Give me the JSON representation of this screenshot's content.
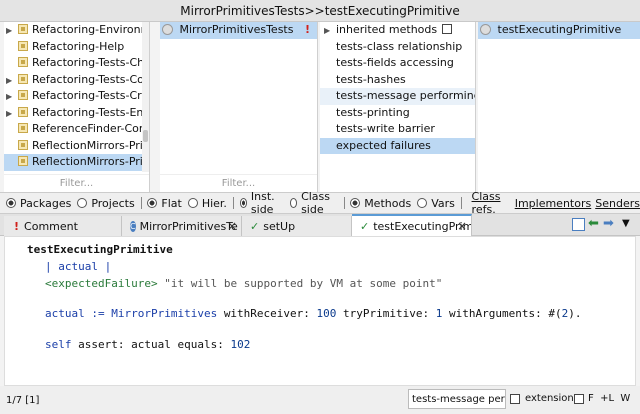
{
  "window": {
    "title": "MirrorPrimitivesTests>>testExecutingPrimitive"
  },
  "packages": {
    "items": [
      {
        "label": "Refactoring-Environment",
        "arrow": "▶",
        "selected": false
      },
      {
        "label": "Refactoring-Help",
        "arrow": "",
        "selected": false
      },
      {
        "label": "Refactoring-Tests-Changes",
        "arrow": "",
        "selected": false
      },
      {
        "label": "Refactoring-Tests-Core",
        "arrow": "▶",
        "selected": false
      },
      {
        "label": "Refactoring-Tests-Critics",
        "arrow": "▶",
        "selected": false
      },
      {
        "label": "Refactoring-Tests-Environment",
        "arrow": "▶",
        "selected": false
      },
      {
        "label": "ReferenceFinder-Core",
        "arrow": "",
        "selected": false
      },
      {
        "label": "ReflectionMirrors-Primitives",
        "arrow": "",
        "selected": false
      },
      {
        "label": "ReflectionMirrors-Primitives-Tests",
        "arrow": "",
        "selected": true
      }
    ],
    "filter": "Filter..."
  },
  "classes": {
    "items": [
      {
        "label": "MirrorPrimitivesTests",
        "badge": "!"
      }
    ],
    "filter": "Filter..."
  },
  "protocols": {
    "items": [
      {
        "label": "inherited methods",
        "checkbox": true
      },
      {
        "label": "tests-class relationship"
      },
      {
        "label": "tests-fields accessing"
      },
      {
        "label": "tests-hashes"
      },
      {
        "label": "tests-message performing"
      },
      {
        "label": "tests-printing"
      },
      {
        "label": "tests-write barrier"
      },
      {
        "label": "expected failures"
      }
    ]
  },
  "methods": {
    "items": [
      {
        "label": "testExecutingPrimitive"
      }
    ]
  },
  "radiobar": {
    "packages": "Packages",
    "projects": "Projects",
    "flat": "Flat",
    "hier": "Hier.",
    "inst_side": "Inst. side",
    "class_side": "Class side",
    "methods": "Methods",
    "vars": "Vars",
    "class_refs": "Class refs.",
    "implementors": "Implementors",
    "senders": "Senders"
  },
  "tabs": [
    {
      "label": "Comment",
      "icon": "!"
    },
    {
      "label": "MirrorPrimitivesTe",
      "icon": "C"
    },
    {
      "label": "setUp",
      "icon": "✓"
    },
    {
      "label": "testExecutingPrim",
      "icon": "✓"
    }
  ],
  "code": {
    "selector": "testExecutingPrimitive",
    "temps": "| actual |",
    "pragma": "<expectedFailure>",
    "comment": "\"it will be supported by VM at some point\"",
    "l3_a": "actual := MirrorPrimitives ",
    "l3_b": "withReceiver: ",
    "l3_c": "100",
    "l3_d": " tryPrimitive: ",
    "l3_e": "1",
    "l3_f": " withArguments: #(",
    "l3_g": "2",
    "l3_h": ").",
    "l4_a": "self ",
    "l4_b": "assert: actual ",
    "l4_c": "equals: ",
    "l4_d": "102"
  },
  "status": {
    "position": "1/7 [1]",
    "protocol_value": "tests-message perform",
    "extension": "extension",
    "flags": "F  +L  W"
  },
  "colors": {
    "selection": "#bcd8f3",
    "accent": "#5b9bd5",
    "error": "#d0211b",
    "keyword": "#1a3ea8",
    "number": "#0b3a8c"
  }
}
